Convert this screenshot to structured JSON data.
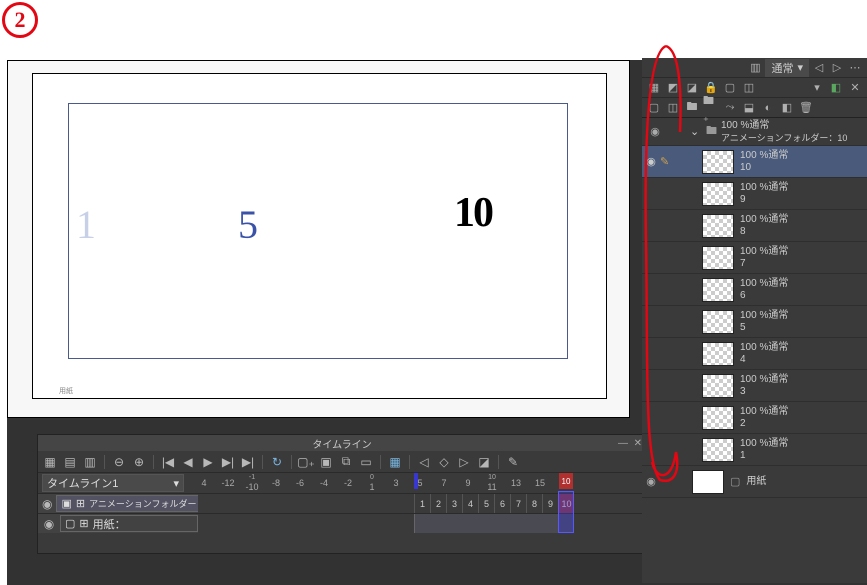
{
  "annotation": {
    "number": "2"
  },
  "canvas": {
    "text1": "1",
    "text5": "5",
    "text10": "10",
    "bottom_label": "用紙"
  },
  "timeline": {
    "title": "タイムライン",
    "name": "タイムライン1",
    "ruler": [
      "4",
      "-12",
      "-1\n-10",
      "-8",
      "-6",
      "-4",
      "-2",
      "0\n1",
      "3",
      "5",
      "7",
      "9",
      "10\n11",
      "13",
      "15",
      "1"
    ],
    "end_label": "10",
    "track1": {
      "label": "アニメーションフォルダー",
      "frames": [
        "1",
        "2",
        "3",
        "4",
        "5",
        "6",
        "7",
        "8",
        "9",
        "10"
      ]
    },
    "track2": {
      "label": "用紙："
    }
  },
  "layers": {
    "folder_opacity": "100 %通常",
    "folder_name": "アニメーションフォルダー：10",
    "items": [
      {
        "opacity": "100 %通常",
        "name": "10"
      },
      {
        "opacity": "100 %通常",
        "name": "9"
      },
      {
        "opacity": "100 %通常",
        "name": "8"
      },
      {
        "opacity": "100 %通常",
        "name": "7"
      },
      {
        "opacity": "100 %通常",
        "name": "6"
      },
      {
        "opacity": "100 %通常",
        "name": "5"
      },
      {
        "opacity": "100 %通常",
        "name": "4"
      },
      {
        "opacity": "100 %通常",
        "name": "3"
      },
      {
        "opacity": "100 %通常",
        "name": "2"
      },
      {
        "opacity": "100 %通常",
        "name": "1"
      }
    ],
    "paper": "用紙"
  },
  "top_dropdown": "通常"
}
